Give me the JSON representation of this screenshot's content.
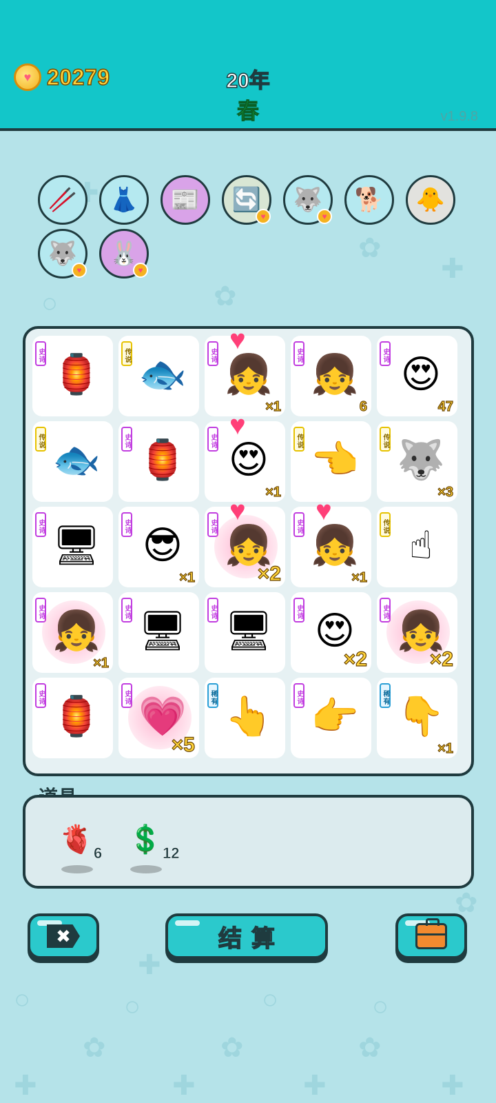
{
  "header": {
    "coins": "20279",
    "year": "20年",
    "season": "春",
    "version": "v1.9.8"
  },
  "owned_items": [
    {
      "name": "chopsticks-icon",
      "bg": "#b5e9f0",
      "glyph": "🥢"
    },
    {
      "name": "skirt-icon",
      "bg": "#b5e9f0",
      "glyph": "👗"
    },
    {
      "name": "time-magazine-icon",
      "bg": "#d9a3e8",
      "glyph": "📰"
    },
    {
      "name": "refresh-icon",
      "bg": "#d8e6d4",
      "glyph": "🔄",
      "heart": true
    },
    {
      "name": "husky-icon",
      "bg": "#b5e9f0",
      "glyph": "🐺",
      "heart": true
    },
    {
      "name": "cool-dog-icon",
      "bg": "#b5e9f0",
      "glyph": "🐕"
    },
    {
      "name": "chick-egg-icon",
      "bg": "#e2e2de",
      "glyph": "🐥"
    },
    {
      "name": "husky-icon-2",
      "bg": "#b5e9f0",
      "glyph": "🐺",
      "heart": true
    },
    {
      "name": "rabbit-icon",
      "bg": "#d9a3e8",
      "glyph": "🐰",
      "heart": true
    }
  ],
  "tags": {
    "epic": "史诗",
    "legend": "传说",
    "rare": "稀有"
  },
  "board": [
    {
      "tag": "epic",
      "art": "rabbit-house-icon",
      "glyph": "🏮"
    },
    {
      "tag": "legend",
      "art": "koi-fish-icon",
      "glyph": "🐟"
    },
    {
      "tag": "epic",
      "art": "girl-heart-icon",
      "glyph": "👧",
      "top_heart": true,
      "count": "×1"
    },
    {
      "tag": "epic",
      "art": "girl-icon",
      "glyph": "👧",
      "count": "6"
    },
    {
      "tag": "epic",
      "art": "beard-man-love-icon",
      "glyph": "😍",
      "count": "47"
    },
    {
      "tag": "legend",
      "art": "koi-fish-icon",
      "glyph": "🐟"
    },
    {
      "tag": "epic",
      "art": "rabbit-house-icon",
      "glyph": "🏮"
    },
    {
      "tag": "epic",
      "art": "green-hat-love-icon",
      "glyph": "😍",
      "top_heart": true,
      "count": "×1"
    },
    {
      "tag": "legend",
      "art": "pointing-left-hand-icon",
      "glyph": "👈"
    },
    {
      "tag": "legend",
      "art": "king-husky-icon",
      "glyph": "🐺",
      "count": "×3"
    },
    {
      "tag": "epic",
      "art": "graphics-card-icon",
      "glyph": "🖥"
    },
    {
      "tag": "epic",
      "art": "green-hat-man-icon",
      "glyph": "😎",
      "count": "×1"
    },
    {
      "tag": "epic",
      "art": "girl-glow-heart-icon",
      "glyph": "👧",
      "top_heart": true,
      "glow": true,
      "count": "×2",
      "big": true
    },
    {
      "tag": "epic",
      "art": "girl-heart-icon",
      "glyph": "👧",
      "top_heart": true,
      "count": "×1"
    },
    {
      "tag": "legend",
      "art": "pointing-up-hand-icon",
      "glyph": "☝"
    },
    {
      "tag": "epic",
      "art": "girl-glow-icon",
      "glyph": "👧",
      "glow": true,
      "count": "×1"
    },
    {
      "tag": "epic",
      "art": "graphics-card-icon",
      "glyph": "🖥"
    },
    {
      "tag": "epic",
      "art": "graphics-card-icon",
      "glyph": "🖥"
    },
    {
      "tag": "epic",
      "art": "love-emoji-icon",
      "glyph": "😍",
      "count": "×2",
      "big": true
    },
    {
      "tag": "epic",
      "art": "girl-glow-icon",
      "glyph": "👧",
      "glow": true,
      "count": "×2",
      "big": true
    },
    {
      "tag": "epic",
      "art": "rabbit-house-icon",
      "glyph": "🏮"
    },
    {
      "tag": "epic",
      "art": "heart-face-icon",
      "glyph": "💗",
      "glow": true,
      "count": "×5",
      "big": true
    },
    {
      "tag": "rare",
      "art": "brown-pointing-hand-icon",
      "glyph": "👆"
    },
    {
      "tag": "epic",
      "art": "gray-pointing-hand-icon",
      "glyph": "👉"
    },
    {
      "tag": "rare",
      "art": "brown-pointing-down-icon",
      "glyph": "👇",
      "count": "×1"
    }
  ],
  "props": {
    "title": "道具",
    "items": [
      {
        "name": "liver-icon",
        "glyph": "🫀",
        "count": "6"
      },
      {
        "name": "dollar-coin-icon",
        "glyph": "💲",
        "count": "12"
      }
    ]
  },
  "buttons": {
    "close": "✖",
    "settle": "结算"
  }
}
